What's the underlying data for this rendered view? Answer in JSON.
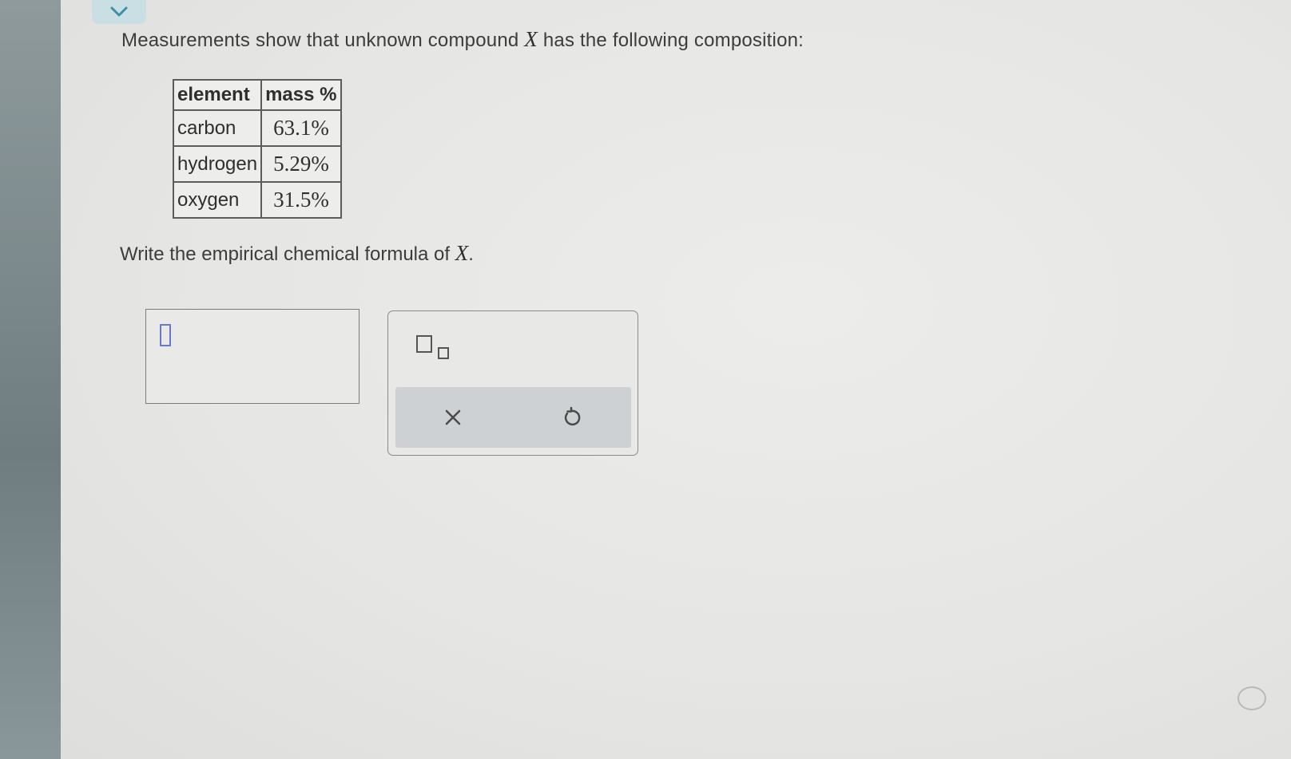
{
  "question": {
    "intro_before_var": "Measurements show that unknown compound ",
    "variable": "X",
    "intro_after_var": " has the following composition:"
  },
  "table": {
    "headers": [
      "element",
      "mass %"
    ],
    "rows": [
      {
        "element": "carbon",
        "mass": "63.1%"
      },
      {
        "element": "hydrogen",
        "mass": "5.29%"
      },
      {
        "element": "oxygen",
        "mass": "31.5%"
      }
    ]
  },
  "prompt": {
    "text_before_var": "Write the empirical chemical formula of ",
    "variable": "X",
    "text_after_var": "."
  },
  "answer": {
    "value": ""
  },
  "palette": {
    "tools": [
      "subscript-icon"
    ],
    "actions": [
      "clear-icon",
      "undo-icon"
    ]
  },
  "colors": {
    "cursor_accent": "#6b78c9",
    "collapse_tab": "#c9dfe3",
    "action_bar": "#cdd1d3"
  }
}
